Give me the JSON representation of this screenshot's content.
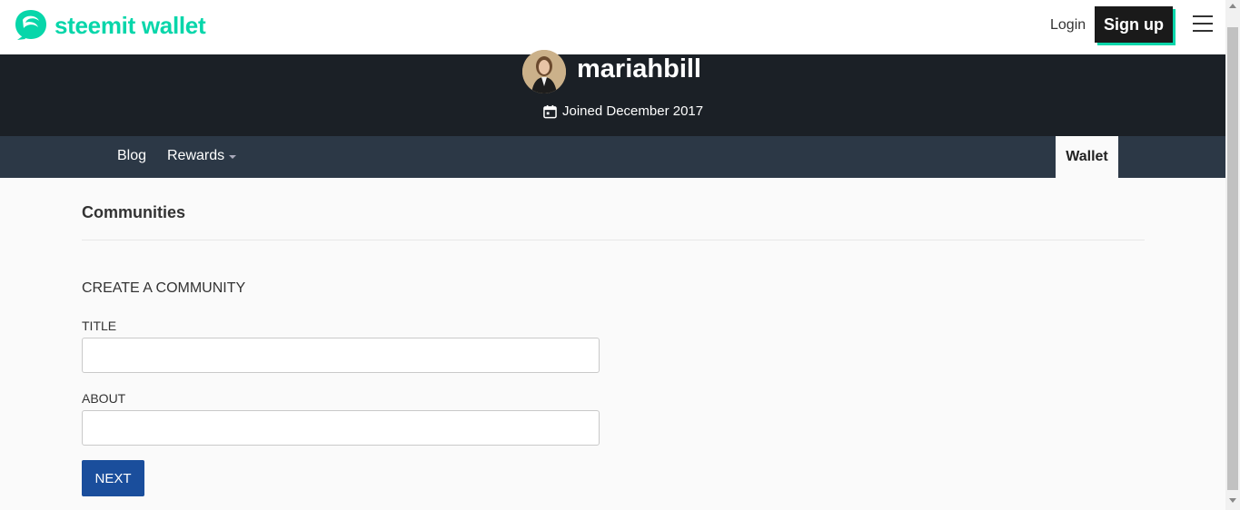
{
  "header": {
    "brand": "steemit wallet",
    "login_label": "Login",
    "signup_label": "Sign up",
    "brand_color": "#07d6aa"
  },
  "profile": {
    "username": "mariahbill",
    "joined": "Joined December 2017"
  },
  "nav": {
    "items": [
      {
        "label": "Blog"
      },
      {
        "label": "Rewards"
      }
    ],
    "active_label": "Wallet"
  },
  "main": {
    "section_title": "Communities",
    "form": {
      "heading": "CREATE A COMMUNITY",
      "title_label": "TITLE",
      "title_value": "",
      "about_label": "ABOUT",
      "about_value": "",
      "next_label": "NEXT"
    }
  },
  "colors": {
    "banner_bg": "#1b2026",
    "nav_bg": "#2c3846",
    "button_bg": "#1a4e9c"
  }
}
